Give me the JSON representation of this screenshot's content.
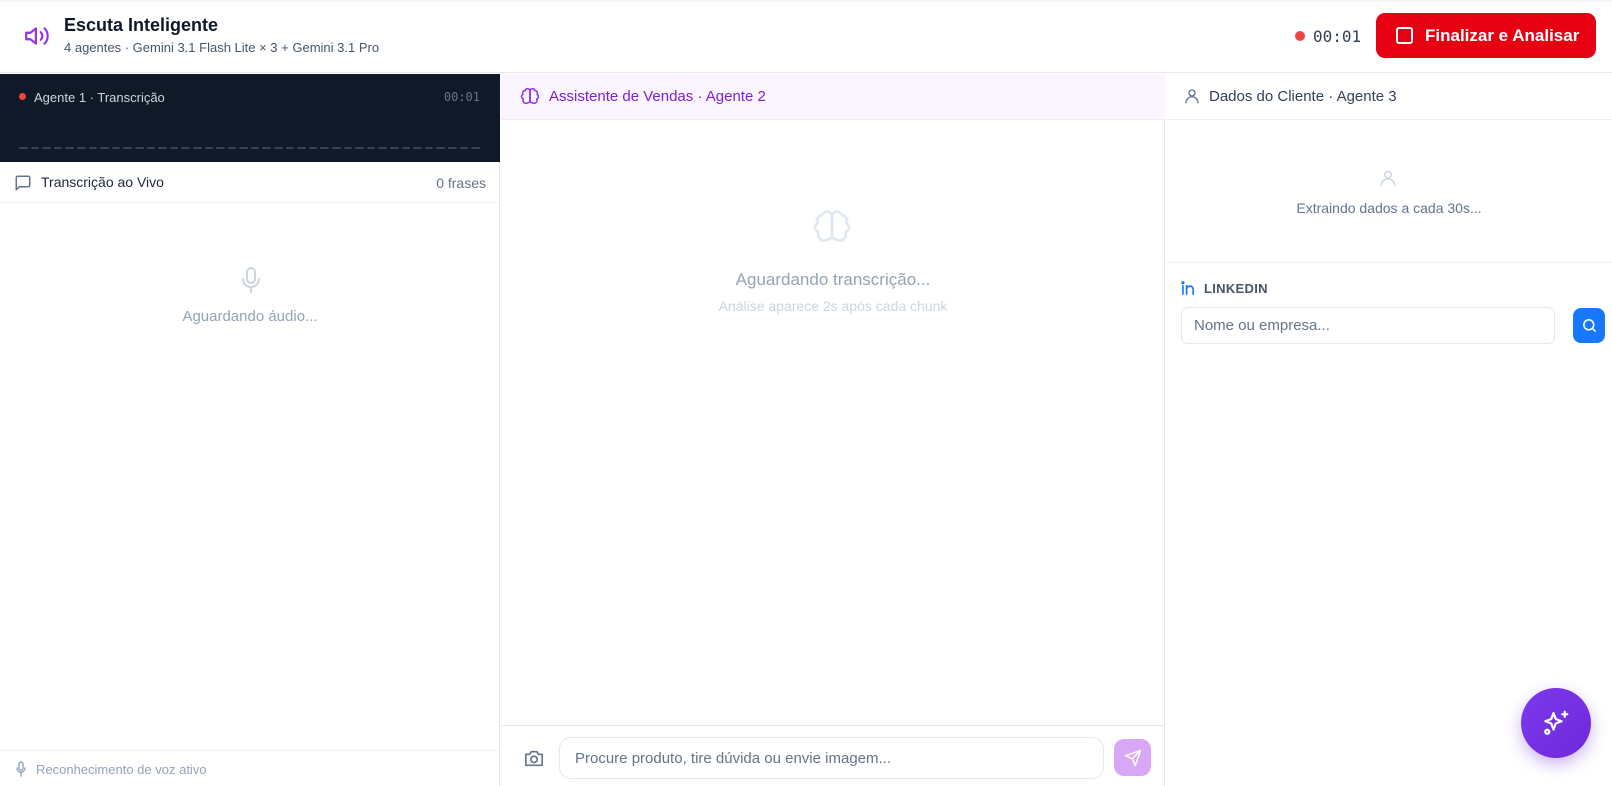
{
  "header": {
    "title": "Escuta Inteligente",
    "subtitle": "4 agentes · Gemini 3.1 Flash Lite × 3 + Gemini 3.1 Pro",
    "timer": "00:01",
    "finish_label": "Finalizar e Analisar"
  },
  "left": {
    "agent_title": "Agente 1 · Transcrição",
    "agent_time": "00:01",
    "live_title": "Transcrição ao Vivo",
    "phrase_count": "0 frases",
    "empty_text": "Aguardando áudio...",
    "footer_text": "Reconhecimento de voz ativo"
  },
  "middle": {
    "title": "Assistente de Vendas · Agente 2",
    "empty_title": "Aguardando transcrição...",
    "empty_sub": "Análise aparece 2s após cada chunk",
    "input_placeholder": "Procure produto, tire dúvida ou envie imagem..."
  },
  "right": {
    "title": "Dados do Cliente · Agente 3",
    "empty_text": "Extraindo dados a cada 30s...",
    "linkedin_label": "LINKEDIN",
    "linkedin_placeholder": "Nome ou empresa..."
  },
  "colors": {
    "accent_purple": "#7e22ce",
    "danger_red": "#e60012",
    "linkedin_blue": "#1677ff",
    "dark_panel": "#111827"
  },
  "icons": [
    "speaker-icon",
    "stop-icon",
    "chat-bubble-icon",
    "mic-icon",
    "brain-icon",
    "camera-icon",
    "send-icon",
    "user-icon",
    "linkedin-icon",
    "search-icon",
    "sparkles-icon"
  ]
}
